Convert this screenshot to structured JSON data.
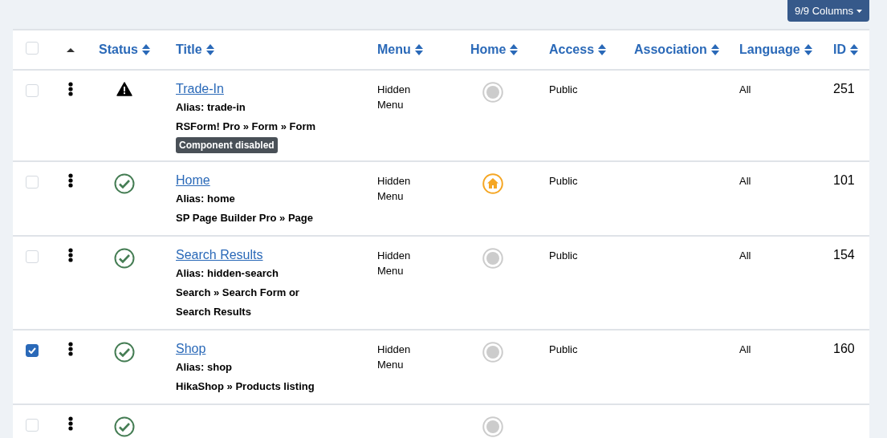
{
  "toolbar": {
    "columns_button": "9/9 Columns"
  },
  "table": {
    "select_all": {
      "checked": false
    },
    "columns": [
      {
        "label": "Status"
      },
      {
        "label": "Title"
      },
      {
        "label": "Menu"
      },
      {
        "label": "Home"
      },
      {
        "label": "Access"
      },
      {
        "label": "Association"
      },
      {
        "label": "Language"
      },
      {
        "label": "ID"
      }
    ],
    "rows": [
      {
        "checked": false,
        "published": false,
        "title": "Trade-In",
        "alias": "Alias: trade-in",
        "type": "RSForm! Pro » Form » Form",
        "badge": "Component disabled",
        "menu": "Hidden Menu",
        "home": false,
        "access": "Public",
        "language": "All",
        "id": "251"
      },
      {
        "checked": false,
        "published": true,
        "title": "Home",
        "alias": "Alias: home",
        "type": "SP Page Builder Pro » Page",
        "menu": "Hidden Menu",
        "home": true,
        "access": "Public",
        "language": "All",
        "id": "101"
      },
      {
        "checked": false,
        "published": true,
        "title": "Search Results",
        "alias": "Alias: hidden-search",
        "type": "Search » Search Form or Search Results",
        "menu": "Hidden Menu",
        "home": false,
        "access": "Public",
        "language": "All",
        "id": "154"
      },
      {
        "checked": true,
        "published": true,
        "title": "Shop",
        "alias": "Alias: shop",
        "type": "HikaShop » Products listing",
        "menu": "Hidden Menu",
        "home": false,
        "access": "Public",
        "language": "All",
        "id": "160"
      },
      {
        "checked": false,
        "published": true,
        "home": false
      }
    ]
  }
}
